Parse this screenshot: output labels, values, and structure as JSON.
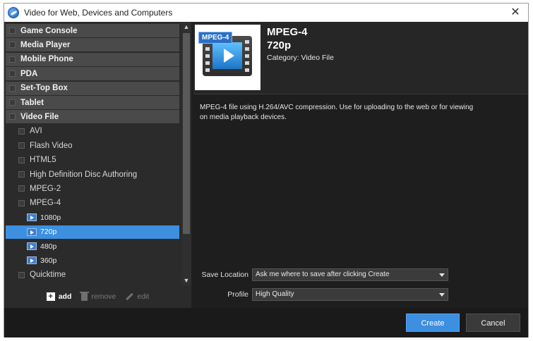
{
  "window": {
    "title": "Video for Web, Devices and Computers",
    "close_glyph": "✕"
  },
  "tree": {
    "rows": [
      {
        "label": "Game Console",
        "kind": "category"
      },
      {
        "label": "Media Player",
        "kind": "category"
      },
      {
        "label": "Mobile Phone",
        "kind": "category"
      },
      {
        "label": "PDA",
        "kind": "category"
      },
      {
        "label": "Set-Top Box",
        "kind": "category"
      },
      {
        "label": "Tablet",
        "kind": "category"
      },
      {
        "label": "Video File",
        "kind": "category"
      },
      {
        "label": "AVI",
        "kind": "sub"
      },
      {
        "label": "Flash Video",
        "kind": "sub"
      },
      {
        "label": "HTML5",
        "kind": "sub"
      },
      {
        "label": "High Definition Disc Authoring",
        "kind": "sub"
      },
      {
        "label": "MPEG-2",
        "kind": "sub"
      },
      {
        "label": "MPEG-4",
        "kind": "sub"
      },
      {
        "label": "1080p",
        "kind": "leaf"
      },
      {
        "label": "720p",
        "kind": "leaf",
        "selected": true
      },
      {
        "label": "480p",
        "kind": "leaf"
      },
      {
        "label": "360p",
        "kind": "leaf"
      },
      {
        "label": "Quicktime",
        "kind": "sub"
      }
    ]
  },
  "toolbar": {
    "add": "add",
    "remove": "remove",
    "edit": "edit",
    "plus_glyph": "+"
  },
  "preset": {
    "badge": "MPEG-4",
    "title": "MPEG-4",
    "subtitle": "720p",
    "category": "Category: Video File",
    "description": "MPEG-4 file using H.264/AVC compression. Use for uploading to the web or for viewing on media playback devices."
  },
  "fields": {
    "save_location_label": "Save Location",
    "save_location_value": "Ask me where to save after clicking Create",
    "profile_label": "Profile",
    "profile_value": "High Quality"
  },
  "buttons": {
    "create": "Create",
    "cancel": "Cancel"
  },
  "scroll": {
    "up": "▲",
    "down": "▼"
  },
  "colors": {
    "accent": "#3d8fe0",
    "panel": "#2b2b2b",
    "background": "#1e1e1e"
  }
}
